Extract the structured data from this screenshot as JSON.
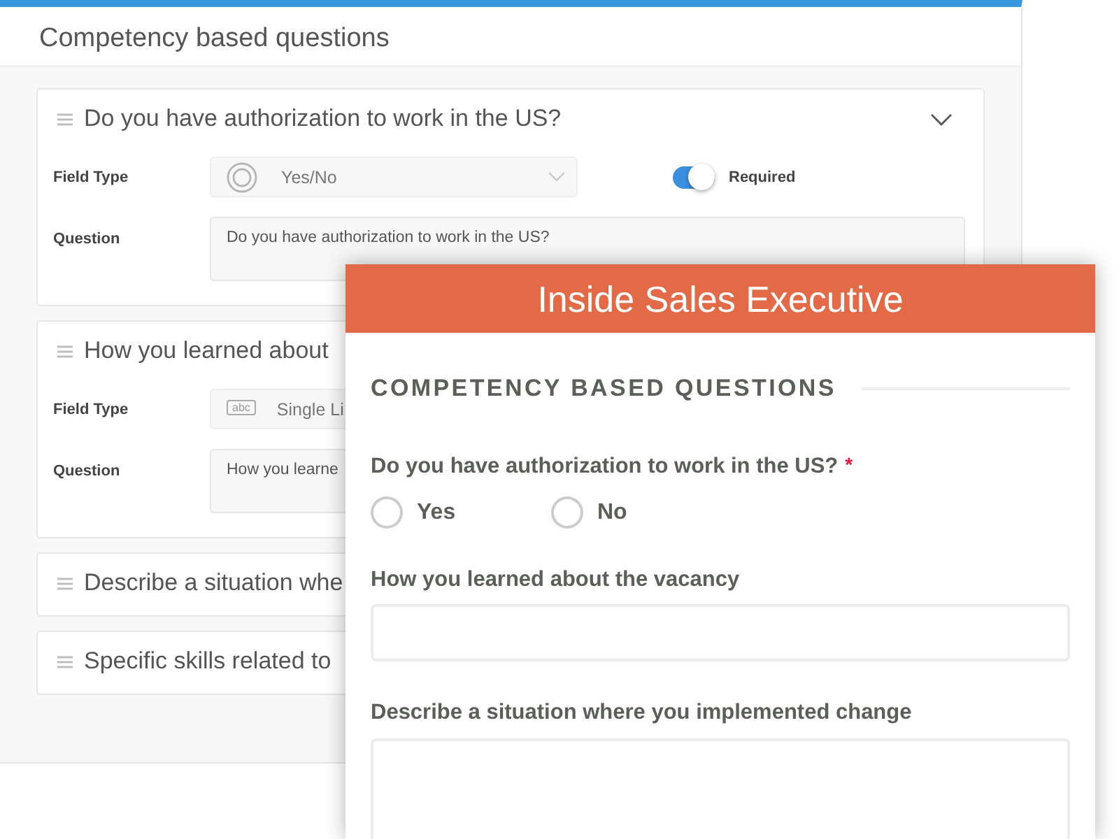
{
  "editor": {
    "title": "Competency based questions",
    "questions": [
      {
        "title": "Do you have authorization to work in the US?",
        "expanded": true,
        "field_type_label": "Field Type",
        "field_type": {
          "kind": "yes_no",
          "value": "Yes/No"
        },
        "required": {
          "label": "Required",
          "on": true
        },
        "question_label": "Question",
        "question_value": "Do you have authorization to work in the US?"
      },
      {
        "title": "How you learned about",
        "expanded": true,
        "field_type_label": "Field Type",
        "field_type": {
          "kind": "single_line",
          "icon_text": "abc",
          "value": "Single Li"
        },
        "question_label": "Question",
        "question_value": "How you learne"
      },
      {
        "title": "Describe a situation whe",
        "expanded": false
      },
      {
        "title": "Specific skills related to",
        "expanded": false
      }
    ]
  },
  "preview": {
    "title": "Inside Sales Executive",
    "section_title": "COMPETENCY BASED QUESTIONS",
    "fields": [
      {
        "kind": "radio",
        "label": "Do you have authorization to work in the US?",
        "required_mark": "*",
        "options": [
          {
            "label": "Yes",
            "selected": false
          },
          {
            "label": "No",
            "selected": false
          }
        ]
      },
      {
        "kind": "text",
        "label": "How you learned about the vacancy"
      },
      {
        "kind": "textarea",
        "label": "Describe a situation where you implemented change"
      }
    ]
  }
}
